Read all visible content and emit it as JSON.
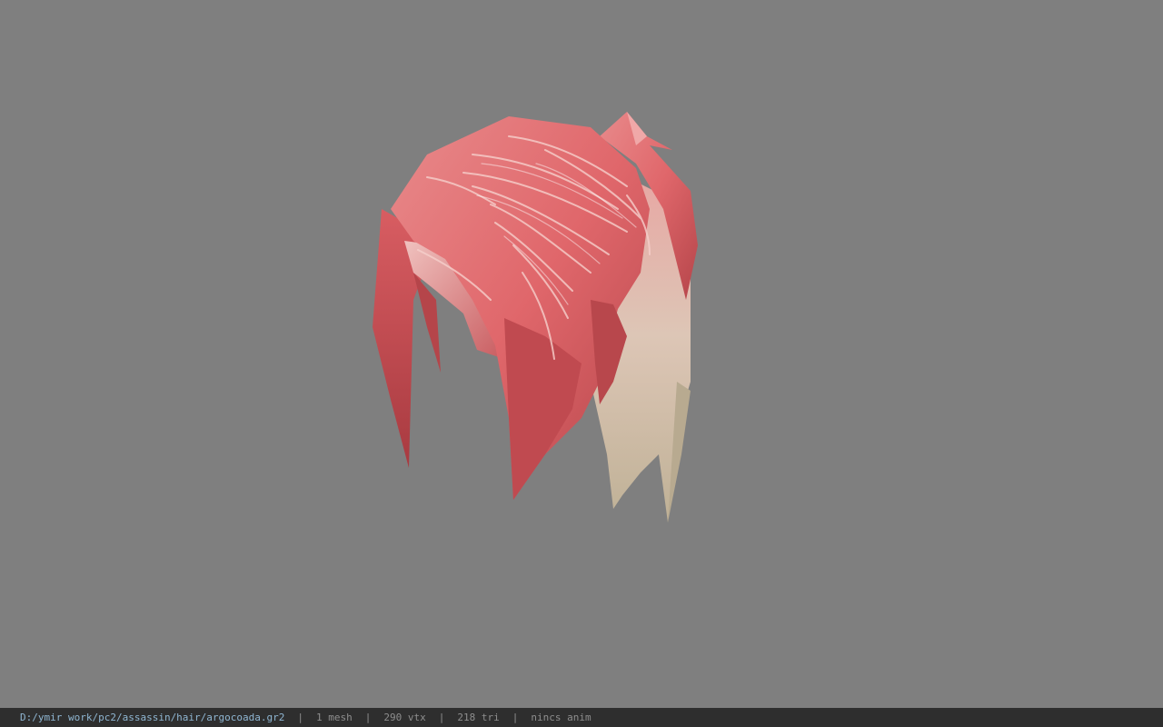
{
  "viewport": {
    "background_color": "#7f7f7f",
    "model_colors": {
      "hair_pink": "#e0676b",
      "hair_dark": "#b5454a",
      "hair_highlight": "#f2b8b6",
      "hair_blonde": "#cdbfa6"
    }
  },
  "status_bar": {
    "file_path": "D:/ymir work/pc2/assassin/hair/argocoada.gr2",
    "separator": "|",
    "mesh_count": "1 mesh",
    "vertex_count": "290 vtx",
    "triangle_count": "218 tri",
    "animation_status": "nincs anim"
  }
}
